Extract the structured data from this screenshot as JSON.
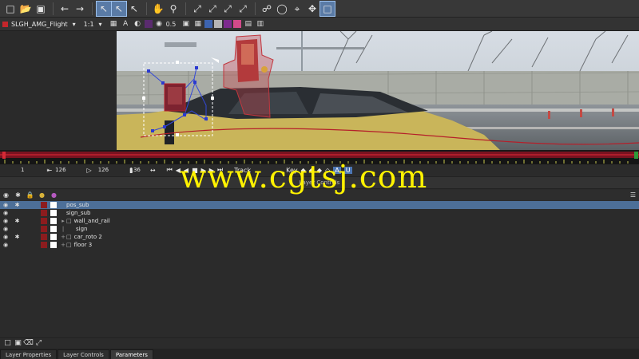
{
  "toolbar": {
    "icons": [
      "new-file-icon",
      "open-file-icon",
      "save-icon",
      "undo-icon",
      "redo-icon",
      "select-tool-icon",
      "select-b-tool-icon",
      "select-plus-tool-icon",
      "hand-tool-icon",
      "zoom-tool-icon",
      "transform-a-icon",
      "transform-b-icon",
      "transform-c-icon",
      "transform-d-icon",
      "link-icon",
      "lasso-icon",
      "pin-icon",
      "move-icon",
      "frame-icon"
    ]
  },
  "toolbar2": {
    "clip_name": "SLGH_AMG_Flight",
    "zoom": "1:1",
    "opacity": "0.5",
    "channel_label": "A"
  },
  "timeline": {
    "start": "1",
    "in_frame": "126",
    "current_frame": "126",
    "out_frame": "136",
    "key_label": "Key",
    "track_label": "Track"
  },
  "panel_title": "Layer Controls",
  "watermark": "www.cgtsj.com",
  "layers": [
    {
      "name": "pos_sub",
      "selected": true,
      "indent": 0,
      "folder": false
    },
    {
      "name": "sign_sub",
      "selected": false,
      "indent": 0,
      "folder": false
    },
    {
      "name": "wall_and_rail",
      "selected": false,
      "indent": 1,
      "folder": true
    },
    {
      "name": "sign",
      "selected": false,
      "indent": 1,
      "folder": false
    },
    {
      "name": "car_roto 2",
      "selected": false,
      "indent": 1,
      "folder": true
    },
    {
      "name": "floor 3",
      "selected": false,
      "indent": 1,
      "folder": true
    }
  ],
  "tabs": [
    {
      "label": "Layer Properties",
      "active": false
    },
    {
      "label": "Layer Controls",
      "active": false
    },
    {
      "label": "Parameters",
      "active": true
    }
  ],
  "colors": {
    "accent": "#c4262b",
    "selection": "#4d6f98",
    "watermark": "#fff200"
  }
}
